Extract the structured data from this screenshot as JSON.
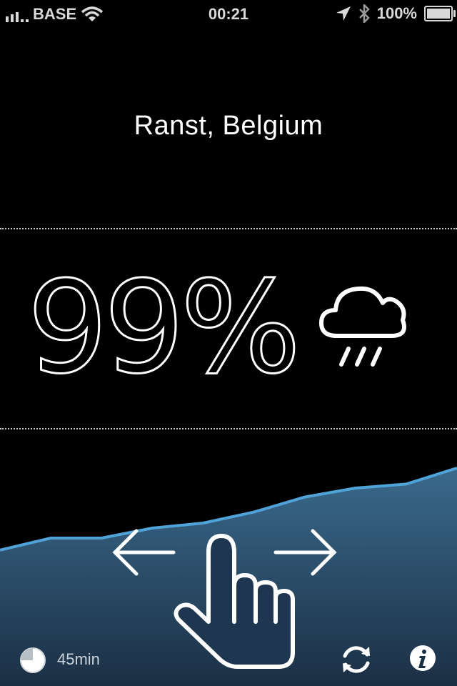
{
  "status_bar": {
    "carrier": "BASE",
    "time": "00:21",
    "battery": "100%",
    "icons": [
      "signal-icon",
      "wifi-icon",
      "location-arrow-icon",
      "bluetooth-icon",
      "battery-icon"
    ]
  },
  "location": "Ranst, Belgium",
  "precipitation": {
    "value": "99%",
    "icon": "rain-cloud-icon"
  },
  "forecast_chart": {
    "type": "area",
    "values": [
      0.18,
      0.3,
      0.3,
      0.4,
      0.45,
      0.56,
      0.71,
      0.8,
      0.84,
      1.0
    ],
    "color_line": "#4fa3d9",
    "color_fill_top": "#3a6a8c",
    "color_fill_bottom": "#1b2f44"
  },
  "gesture_hint": {
    "icons": [
      "arrow-left-icon",
      "hand-swipe-icon",
      "arrow-right-icon"
    ]
  },
  "footer": {
    "timer_label": "45min",
    "timer_fraction": 0.75,
    "icons": [
      "timer-pie-icon",
      "refresh-icon",
      "info-icon"
    ]
  },
  "colors": {
    "background": "#000000",
    "text": "#ffffff",
    "accent": "#4fa3d9"
  }
}
